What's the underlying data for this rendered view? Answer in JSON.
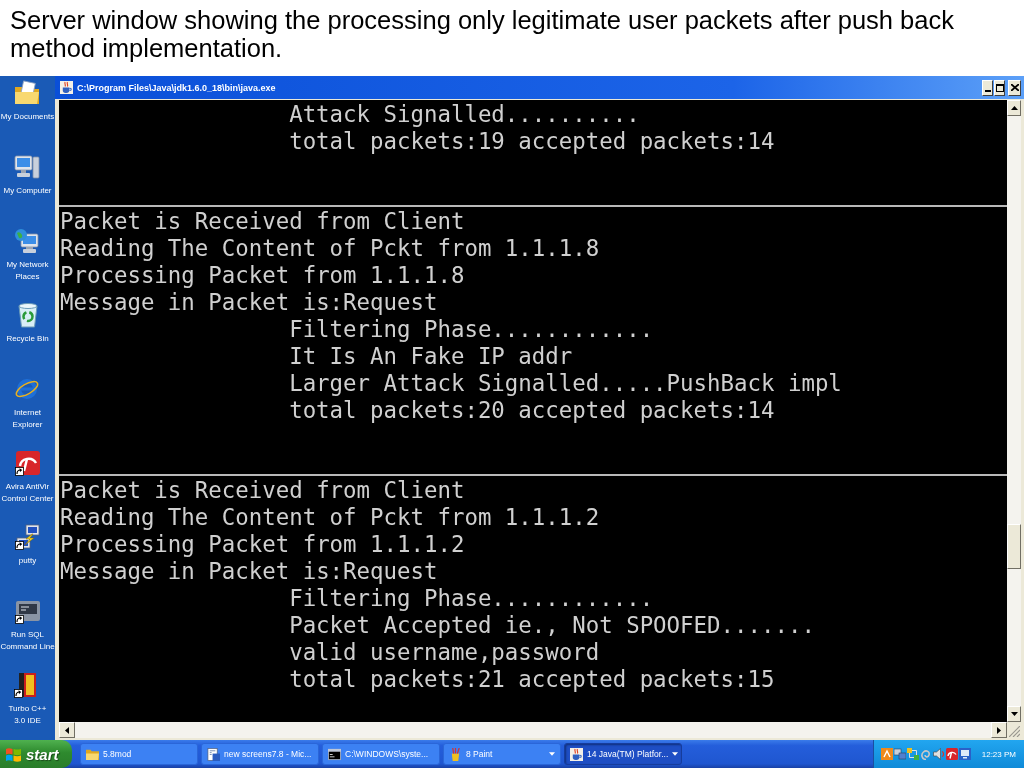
{
  "caption": "Server window showing the processing only legitimate user packets after push back method implementation.",
  "desktop_icons": [
    {
      "label_lines": [
        "My Documents"
      ],
      "kind": "documents",
      "shortcut": false
    },
    {
      "label_lines": [
        "My Computer"
      ],
      "kind": "computer",
      "shortcut": false
    },
    {
      "label_lines": [
        "My Network",
        "Places"
      ],
      "kind": "network",
      "shortcut": false
    },
    {
      "label_lines": [
        "Recycle Bin"
      ],
      "kind": "recycle",
      "shortcut": false
    },
    {
      "label_lines": [
        "Internet",
        "Explorer"
      ],
      "kind": "browser",
      "shortcut": false
    },
    {
      "label_lines": [
        "Avira AntiVir",
        "Control Center"
      ],
      "kind": "antivirus",
      "shortcut": true
    },
    {
      "label_lines": [
        "putty"
      ],
      "kind": "terminal",
      "shortcut": true
    },
    {
      "label_lines": [
        "Run SQL",
        "Command Line"
      ],
      "kind": "database",
      "shortcut": true
    },
    {
      "label_lines": [
        "Turbo C++",
        "3.0 IDE"
      ],
      "kind": "compiler",
      "shortcut": true
    }
  ],
  "window": {
    "title": "C:\\Program Files\\Java\\jdk1.6.0_18\\bin\\java.exe",
    "console": {
      "blocks": [
        {
          "lines": [
            {
              "text": "Attack Signalled..........",
              "indented": true
            },
            {
              "text": "total packets:19 accepted packets:14",
              "indented": true
            }
          ]
        },
        {
          "lines": [
            {
              "text": "Packet is Received from Client",
              "indented": false
            },
            {
              "text": "Reading The Content of Pckt from 1.1.1.8",
              "indented": false
            },
            {
              "text": "Processing Packet from 1.1.1.8",
              "indented": false
            },
            {
              "text": "Message in Packet is:Request",
              "indented": false
            },
            {
              "text": "Filtering Phase............",
              "indented": true
            },
            {
              "text": "It Is An Fake IP addr",
              "indented": true
            },
            {
              "text": "Larger Attack Signalled.....PushBack impl",
              "indented": true
            },
            {
              "text": "total packets:20 accepted packets:14",
              "indented": true
            }
          ]
        },
        {
          "lines": [
            {
              "text": "Packet is Received from Client",
              "indented": false
            },
            {
              "text": "Reading The Content of Pckt from 1.1.1.2",
              "indented": false
            },
            {
              "text": "Processing Packet from 1.1.1.2",
              "indented": false
            },
            {
              "text": "Message in Packet is:Request",
              "indented": false
            },
            {
              "text": "Filtering Phase............",
              "indented": true
            },
            {
              "text": "Packet Accepted ie., Not SPOOFED.......",
              "indented": true
            },
            {
              "text": "valid username,password",
              "indented": true
            },
            {
              "text": "total packets:21 accepted packets:15",
              "indented": true
            }
          ]
        }
      ]
    }
  },
  "taskbar": {
    "start_label": "start",
    "buttons": [
      {
        "label": "5.8mod",
        "kind": "folder",
        "grouped": false,
        "selected": false
      },
      {
        "label": "new screens7.8 - Mic...",
        "kind": "document",
        "grouped": false,
        "selected": false
      },
      {
        "label": "C:\\WINDOWS\\syste...",
        "kind": "console",
        "grouped": false,
        "selected": false
      },
      {
        "label": "8 Paint",
        "kind": "paint",
        "grouped": true,
        "selected": false
      },
      {
        "label": "14 Java(TM) Platfor...",
        "kind": "java",
        "grouped": true,
        "selected": true
      }
    ],
    "clock": "12:23 PM"
  }
}
